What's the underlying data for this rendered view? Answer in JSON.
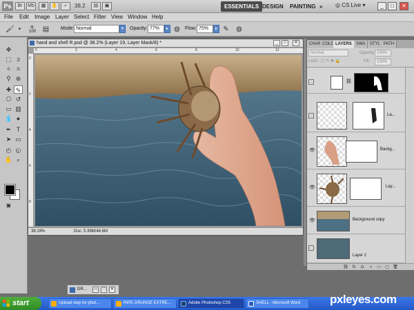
{
  "app": {
    "logo": "Ps",
    "zoom_value": "38.2",
    "cs_live": "CS Live"
  },
  "workspaces": [
    "ESSENTIALS",
    "DESIGN",
    "PAINTING",
    "»"
  ],
  "menu": [
    "File",
    "Edit",
    "Image",
    "Layer",
    "Select",
    "Filter",
    "View",
    "Window",
    "Help"
  ],
  "options": {
    "brush_size": "100",
    "mode_label": "Mode:",
    "mode_value": "Normal",
    "opacity_label": "Opacity:",
    "opacity_value": "77%",
    "flow_label": "Flow:",
    "flow_value": "75%"
  },
  "document": {
    "title": "hand and shell R.psd @ 38.2% (Layer 19, Layer Mask/8) *",
    "zoom": "38.19%",
    "doc_size": "Doc: 5.39M/48.6M",
    "ruler_h": [
      "0",
      "2",
      "4",
      "6",
      "8",
      "10",
      "12"
    ],
    "ruler_v": [
      "0",
      "2",
      "4",
      "6",
      "8"
    ]
  },
  "layers_panel": {
    "tabs": [
      "CHAR",
      "COLC",
      "LAYERS",
      "SWA",
      "STYL",
      "PATH"
    ],
    "blend_mode": "Normal",
    "opacity_label": "Opacity:",
    "opacity_value": "100%",
    "lock_label": "Lock:",
    "fill_label": "Fill:",
    "fill_value": "100%",
    "layers": [
      {
        "name": "",
        "visible": false
      },
      {
        "name": "La...",
        "visible": false
      },
      {
        "name": "Backg...",
        "visible": true
      },
      {
        "name": "Lay...",
        "visible": true
      },
      {
        "name": "Background copy",
        "visible": true
      },
      {
        "name": "Layer 2",
        "visible": false
      }
    ]
  },
  "minimized_panel": {
    "label": "DR..."
  },
  "taskbar": {
    "start": "start",
    "tasks": [
      {
        "label": "Upload step for phot..."
      },
      {
        "label": "RIPE GRUNGE EXTRE..."
      },
      {
        "label": "Adobe Photoshop CS5"
      },
      {
        "label": "SHELL - Microsoft Word"
      }
    ]
  },
  "brand": {
    "part1": "px",
    "part2": "leyes",
    "suffix": ".com"
  },
  "colors": {
    "taskbar": "#2a5fd6",
    "start": "#3a9a2e",
    "selection": "#5a87c7",
    "brand_accent": "#f2a32a"
  }
}
